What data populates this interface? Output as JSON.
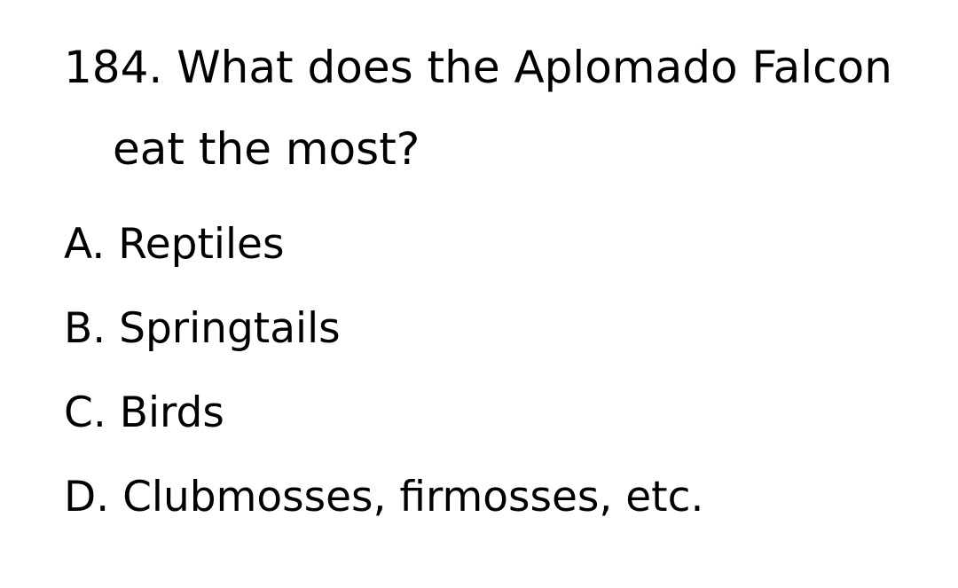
{
  "question": {
    "line1": "184. What does the Aplomado Falcon",
    "line2": "eat the most?"
  },
  "options": [
    {
      "label": "A. Reptiles"
    },
    {
      "label": "B. Springtails"
    },
    {
      "label": "C. Birds"
    },
    {
      "label": "D. Clubmosses, firmosses, etc."
    }
  ],
  "colors": {
    "text": "#000000",
    "background": "#ffffff"
  }
}
